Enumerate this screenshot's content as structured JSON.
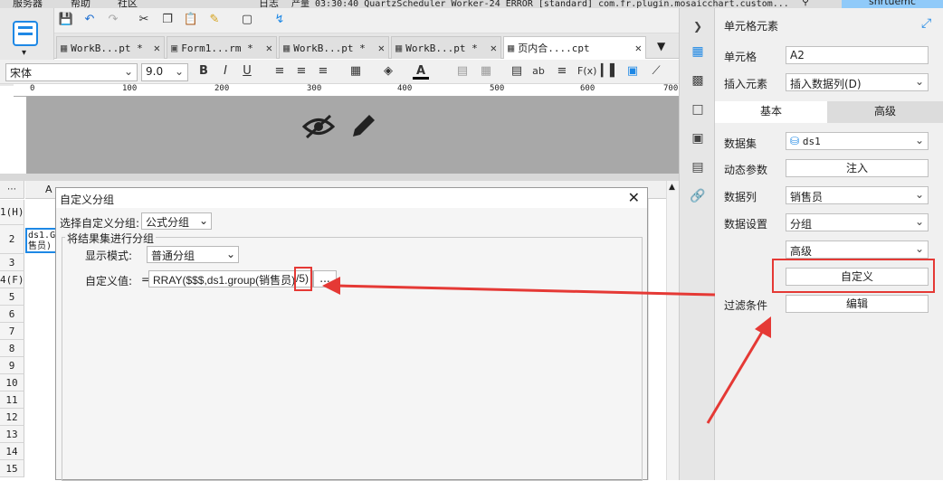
{
  "menubar": {
    "items": [
      "服务器",
      "帮助",
      "社区"
    ],
    "log_label": "日志",
    "log_text": "产量 03:30:40 QuartzScheduler_Worker-24 ERROR [standard] com.fr.plugin.mosaicchart.custom...",
    "user": "snrtuemc"
  },
  "tabs": [
    {
      "label": "WorkB...pt *",
      "icon": "grid-icon"
    },
    {
      "label": "Form1...rm *",
      "icon": "form-icon"
    },
    {
      "label": "WorkB...pt *",
      "icon": "grid-icon"
    },
    {
      "label": "WorkB...pt *",
      "icon": "grid-icon"
    },
    {
      "label": "页内合....cpt",
      "icon": "grid-icon"
    }
  ],
  "format": {
    "font": "宋体",
    "size": "9.0"
  },
  "ruler": {
    "ticks": [
      "0",
      "100",
      "200",
      "300",
      "400",
      "500",
      "600",
      "700"
    ]
  },
  "sheet": {
    "col_a": "A",
    "rows": [
      "1(H)",
      "2",
      "3",
      "4(F)",
      "5",
      "6",
      "7",
      "8",
      "9",
      "10",
      "11",
      "12",
      "13",
      "14",
      "15"
    ],
    "cell_a2": "ds1.G 售员)"
  },
  "dialog": {
    "title": "自定义分组",
    "select_label": "选择自定义分组:",
    "select_value": "公式分组",
    "group_legend": "将结果集进行分组",
    "display_mode_label": "显示模式:",
    "display_mode_value": "普通分组",
    "custom_value_label": "自定义值:",
    "custom_value_prefix": "=",
    "custom_value": "RRAY($$$,ds1.group(销售员)",
    "custom_value_suffix": "/5)",
    "ellipsis": "..."
  },
  "panel": {
    "title": "单元格元素",
    "cell_label": "单元格",
    "cell_value": "A2",
    "insert_label": "插入元素",
    "insert_value": "插入数据列(D)",
    "tab_basic": "基本",
    "tab_advanced": "高级",
    "dataset_label": "数据集",
    "dataset_value": "ds1",
    "dynamic_label": "动态参数",
    "inject_button": "注入",
    "column_label": "数据列",
    "column_value": "销售员",
    "setting_label": "数据设置",
    "setting_value": "分组",
    "advanced_value": "高级",
    "custom_button": "自定义",
    "filter_label": "过滤条件",
    "edit_button": "编辑"
  },
  "colors": {
    "highlight": "#e53935",
    "accent": "#1e88e5"
  }
}
